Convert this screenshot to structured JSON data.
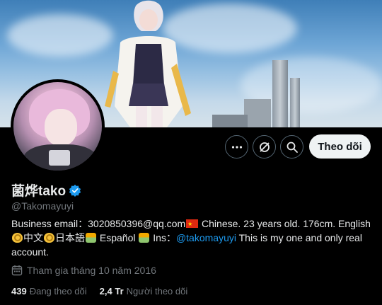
{
  "profile": {
    "display_name": "菌烨tako",
    "handle": "@Takomayuyi",
    "verified": true,
    "verified_color": "#1d9bf0"
  },
  "bio": {
    "part1": "Business email：3020850396@qq.com",
    "part2": " Chinese. 23 years old. 176cm. English ",
    "part3": "中文",
    "part4": "日本語",
    "part5": " Español ",
    "part6": " Ins：",
    "link": "@takomayuyi",
    "part7": " This is my one and only real account."
  },
  "joined": {
    "text": "Tham gia tháng 10 năm 2016",
    "icon": "calendar-icon"
  },
  "stats": {
    "following_count": "439",
    "following_label": "Đang theo dõi",
    "followers_count": "2,4 Tr",
    "followers_label": "Người theo dõi"
  },
  "actions": {
    "more_icon": "more-icon",
    "grok_icon": "grok-icon",
    "search_icon": "search-icon",
    "follow_label": "Theo dõi"
  },
  "colors": {
    "background": "#000000",
    "link": "#1d9bf0",
    "secondary_text": "#71767b",
    "follow_button": "#eff3f4"
  }
}
